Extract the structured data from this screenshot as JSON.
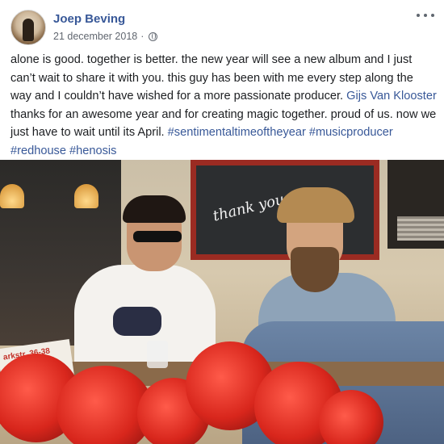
{
  "post": {
    "author": "Joep Beving",
    "date": "21 december 2018",
    "date_separator": "·",
    "privacy_icon": "globe-icon",
    "more_icon": "more-options-icon",
    "text_part1": "alone is good. together is better. the new year will see a new album and I just can’t wait to share it with you. this guy has been with me every step along the way and I couldn’t have wished for a more passionate producer. ",
    "mention": "Gijs Van Klooster",
    "text_part2": " thanks for an awesome year and for creating magic together. proud of us. now we just have to wait until its April. ",
    "hashtags": [
      "#sentimentaltimeoftheyear",
      "#musicproducer",
      "#redhouse",
      "#henosis"
    ]
  },
  "photo": {
    "board_text": "thank you",
    "paper_text": "arkstr. 36-38"
  },
  "colors": {
    "link": "#385898",
    "text": "#1c1e21",
    "meta": "#616770"
  }
}
